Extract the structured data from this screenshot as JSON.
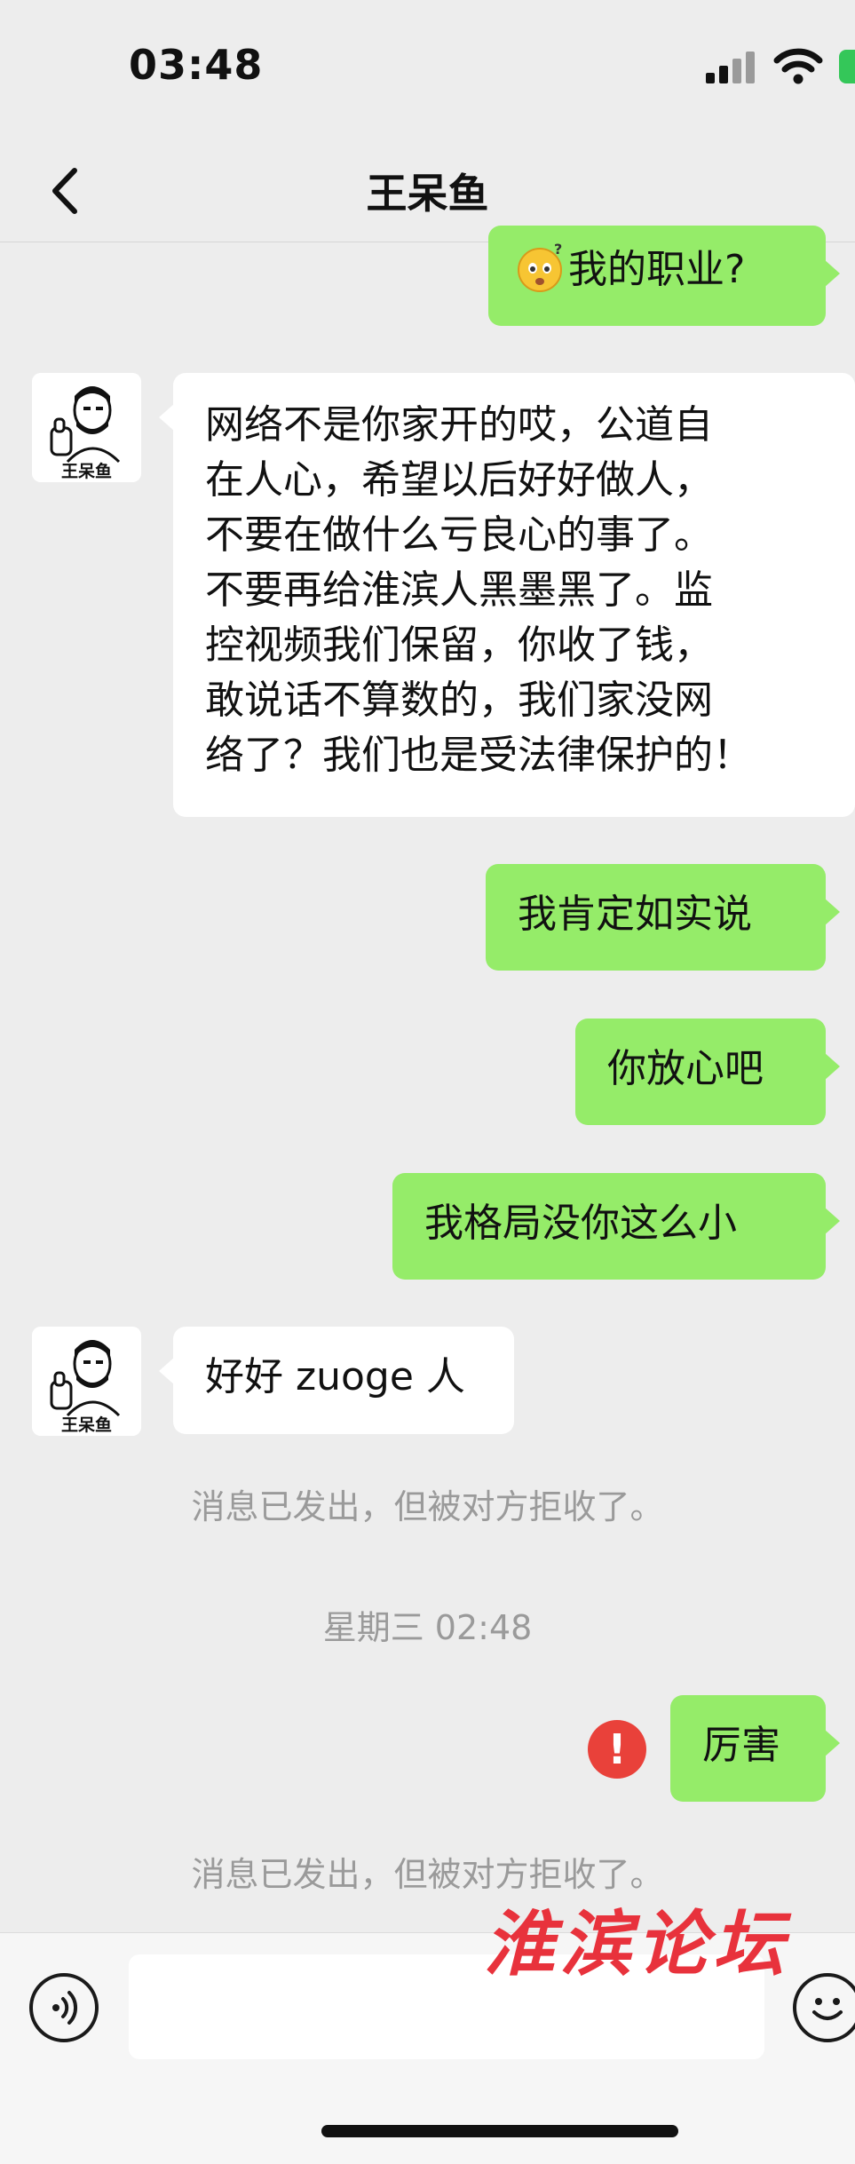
{
  "status": {
    "time": "03:48"
  },
  "nav": {
    "title": "王呆鱼"
  },
  "avatar_caption": "王呆鱼",
  "messages": [
    {
      "side": "out",
      "text": "我的职业?",
      "emoji": "thinking-face"
    },
    {
      "side": "in",
      "lines": [
        "网络不是你家开的哎，公道自",
        "在人心，希望以后好好做人，",
        "不要在做什么亏良心的事了。",
        "不要再给淮滨人黑墨黑了。监",
        "控视频我们保留，你收了钱，",
        "敢说话不算数的，我们家没网",
        "络了？我们也是受法律保护的！"
      ]
    },
    {
      "side": "out",
      "text": "我肯定如实说"
    },
    {
      "side": "out",
      "text": "你放心吧"
    },
    {
      "side": "out",
      "text": "我格局没你这么小"
    },
    {
      "side": "in",
      "text": "好好 zuoge 人"
    },
    {
      "side": "out",
      "text": "厉害",
      "failed": true
    }
  ],
  "system": {
    "rejected_1": "消息已发出，但被对方拒收了。",
    "timestamp": "星期三 02:48",
    "rejected_2": "消息已发出，但被对方拒收了。"
  },
  "error_glyph": "!",
  "watermark": "淮滨论坛",
  "input": {
    "value": "",
    "placeholder": ""
  },
  "colors": {
    "outgoing_bubble": "#95ec69",
    "incoming_bubble": "#ffffff",
    "background": "#ededed",
    "error": "#e9413a"
  }
}
